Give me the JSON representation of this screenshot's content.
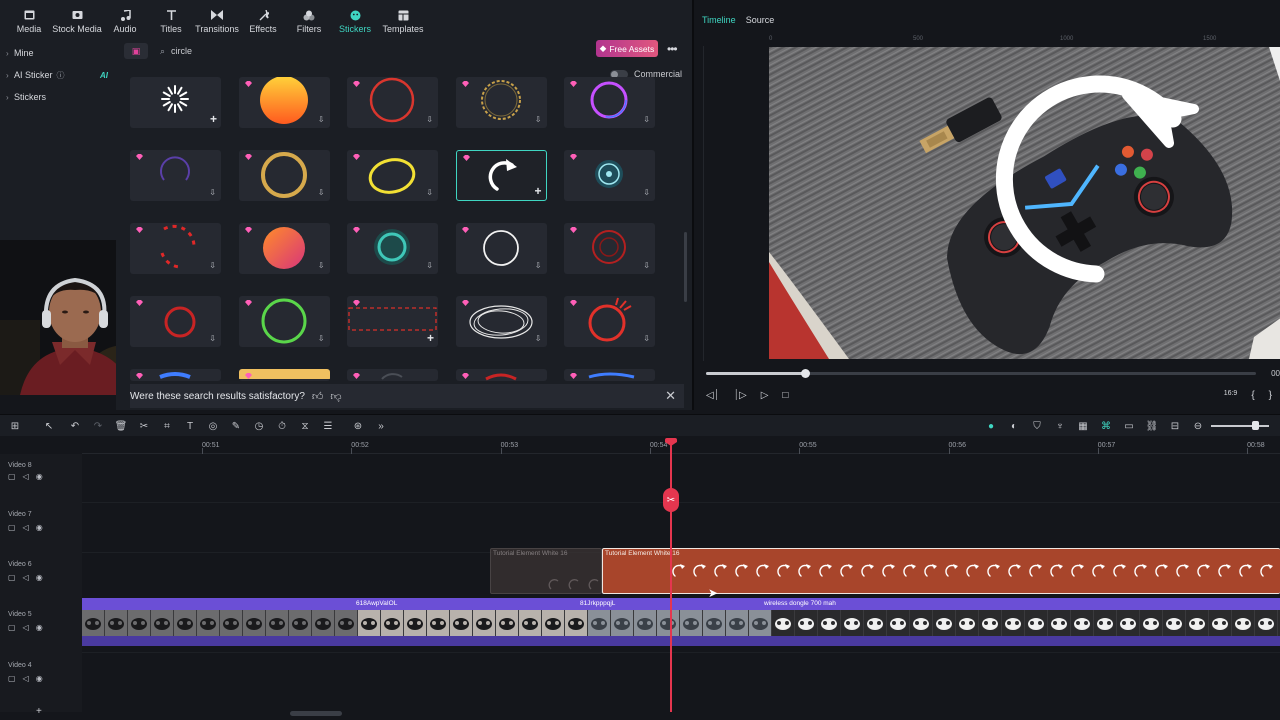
{
  "toolbar": {
    "tabs": [
      {
        "label": "Media",
        "icon": "media-icon"
      },
      {
        "label": "Stock Media",
        "icon": "stock-media-icon"
      },
      {
        "label": "Audio",
        "icon": "audio-icon"
      },
      {
        "label": "Titles",
        "icon": "titles-icon"
      },
      {
        "label": "Transitions",
        "icon": "transitions-icon"
      },
      {
        "label": "Effects",
        "icon": "effects-icon"
      },
      {
        "label": "Filters",
        "icon": "filters-icon"
      },
      {
        "label": "Stickers",
        "icon": "stickers-icon",
        "active": true
      },
      {
        "label": "Templates",
        "icon": "templates-icon"
      }
    ]
  },
  "sidebar": {
    "items": [
      {
        "label": "Mine"
      },
      {
        "label": "AI Sticker",
        "badge": "AI"
      },
      {
        "label": "Stickers"
      }
    ]
  },
  "stickers": {
    "search_query": "circle",
    "free_assets_label": "Free Assets",
    "commercial_label": "Commercial",
    "cards": [
      {
        "type": "spinner",
        "action": "add"
      },
      {
        "type": "orange-orb",
        "action": "download"
      },
      {
        "type": "red-brush-ring",
        "action": "download"
      },
      {
        "type": "gold-sparkle-ring",
        "action": "download"
      },
      {
        "type": "neon-ring",
        "action": "download"
      },
      {
        "type": "purple-arc",
        "action": "download"
      },
      {
        "type": "gold-ring",
        "action": "download"
      },
      {
        "type": "yellow-scribble-ring",
        "action": "download"
      },
      {
        "type": "white-rotate-arrow",
        "action": "add",
        "selected": true
      },
      {
        "type": "glow-target",
        "action": "download"
      },
      {
        "type": "red-dashes",
        "action": "download"
      },
      {
        "type": "orange-pink-orb",
        "action": "download"
      },
      {
        "type": "teal-glow-ring",
        "action": "download"
      },
      {
        "type": "white-ring",
        "action": "download"
      },
      {
        "type": "red-target",
        "action": "download"
      },
      {
        "type": "red-ring-partial",
        "action": "download"
      },
      {
        "type": "green-ring",
        "action": "download"
      },
      {
        "type": "red-dashed-rect",
        "action": "add"
      },
      {
        "type": "white-scribble-ellipse",
        "action": "download"
      },
      {
        "type": "red-splash-ring",
        "action": "download"
      }
    ],
    "feedback_question": "Were these search results satisfactory?"
  },
  "preview": {
    "tab_timeline": "Timeline",
    "tab_source": "Source",
    "ruler_marks": [
      "0",
      "500",
      "1000",
      "1500"
    ],
    "progress": 0.18,
    "time_partial": "00"
  },
  "timeline": {
    "ruler": [
      "00:51",
      "00:52",
      "00:53",
      "00:54",
      "00:55",
      "00:56",
      "00:57",
      "00:58"
    ],
    "tracks": [
      {
        "name": "Video 8"
      },
      {
        "name": "Video 7"
      },
      {
        "name": "Video 6"
      },
      {
        "name": "Video 5"
      },
      {
        "name": "Video 4"
      }
    ],
    "clip_ghost_label": "Tutorial Element White 16",
    "clip_main_label": "Tutorial Element White 16",
    "video5_clips": [
      "618AwpVaIOL",
      "81JrkpppqjL",
      "wireless dongle 700 mah"
    ]
  },
  "colors": {
    "accent": "#3fd6c2",
    "playhead": "#e5364f",
    "sticker_clip": "#a8452b",
    "video_clip": "#6b4fd6"
  }
}
